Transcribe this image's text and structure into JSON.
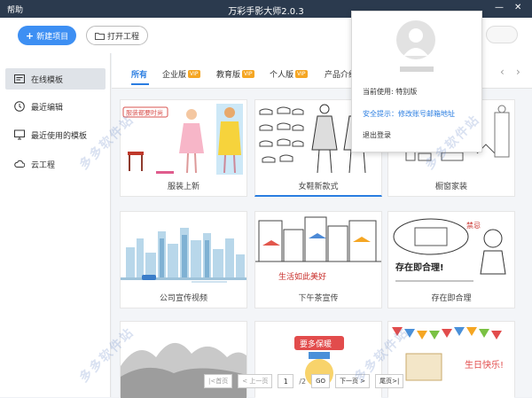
{
  "titlebar": {
    "help": "帮助",
    "title": "万彩手影大师2.0.3",
    "min": "—",
    "close": "✕"
  },
  "toolbar": {
    "new_project": "新建项目",
    "open_project": "打开工程"
  },
  "sidebar": {
    "items": [
      {
        "label": "在线模板",
        "icon": "template-icon"
      },
      {
        "label": "最近编辑",
        "icon": "clock-icon"
      },
      {
        "label": "最近使用的模板",
        "icon": "monitor-icon"
      },
      {
        "label": "云工程",
        "icon": "cloud-icon"
      }
    ]
  },
  "tabs": {
    "items": [
      {
        "label": "所有",
        "vip": ""
      },
      {
        "label": "企业版",
        "vip": "VIP"
      },
      {
        "label": "教育版",
        "vip": "VIP"
      },
      {
        "label": "个人版",
        "vip": "VIP"
      },
      {
        "label": "产品介绍",
        "vip": ""
      }
    ],
    "prev_arrow": "‹",
    "next_arrow": "›"
  },
  "cards": [
    {
      "label": "服装上新"
    },
    {
      "label": "女鞋新款式"
    },
    {
      "label": "橱窗家装"
    },
    {
      "label": "公司宣传视频"
    },
    {
      "label": "下午茶宣传"
    },
    {
      "label": "存在即合理"
    },
    {
      "label": ""
    },
    {
      "label": ""
    },
    {
      "label": ""
    }
  ],
  "thumb_text": {
    "card1": "服装都要时尚",
    "card5": "生活如此美好",
    "card6_sign": "存在即合理!",
    "card6_tag": "禁忌",
    "card8": "要多保暖",
    "card9": "生日快乐!"
  },
  "pager": {
    "first": "|<首页",
    "prev": "< 上一页",
    "page": "1",
    "total": "/2",
    "go": "GO",
    "next": "下一页 >",
    "last": "尾页>|"
  },
  "popup": {
    "current_use": "当前使用: 特别版",
    "security": "安全提示：修改账号邮箱地址",
    "logout": "退出登录"
  },
  "watermark": "多多软件站",
  "colors": {
    "accent": "#2a7de1",
    "button": "#3d8ff3",
    "titlebar": "#2b3a4e",
    "vip": "#f5a623"
  }
}
